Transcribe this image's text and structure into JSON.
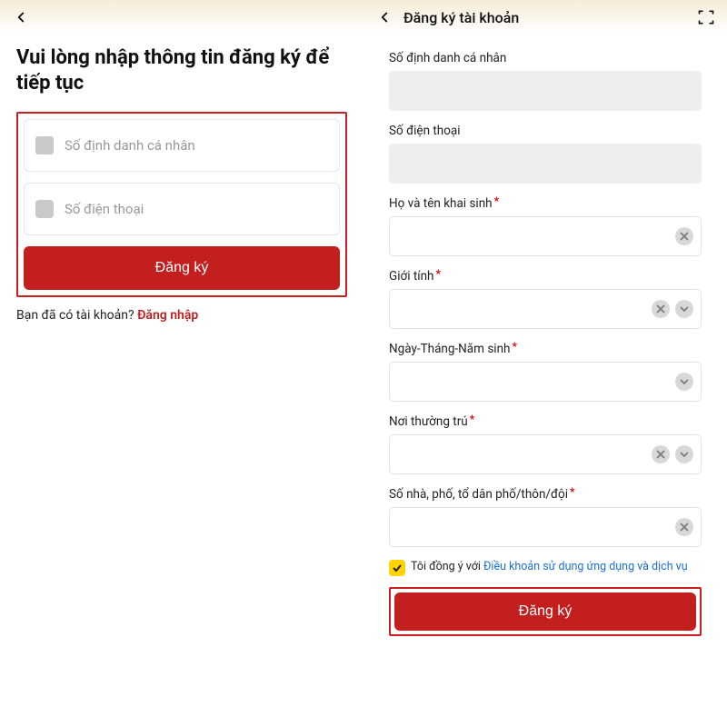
{
  "left": {
    "heading": "Vui lòng nhập thông tin đăng ký để tiếp tục",
    "id_placeholder": "Số định danh cá nhân",
    "phone_placeholder": "Số điện thoại",
    "register_button": "Đăng ký",
    "have_account": "Bạn đã có tài khoản?",
    "login_link": "Đăng nhập"
  },
  "right": {
    "header_title": "Đăng ký tài khoản",
    "labels": {
      "id": "Số định danh cá nhân",
      "phone": "Số điện thoại",
      "fullname": "Họ và tên khai sinh",
      "gender": "Giới tính",
      "dob": "Ngày-Tháng-Năm sinh",
      "residence": "Nơi thường trú",
      "address": "Số nhà, phố, tổ dân phố/thôn/đội"
    },
    "agree_text": "Tôi đồng ý với ",
    "terms_text": "Điều khoản sử dụng ứng dụng và dịch vụ",
    "register_button": "Đăng ký"
  }
}
